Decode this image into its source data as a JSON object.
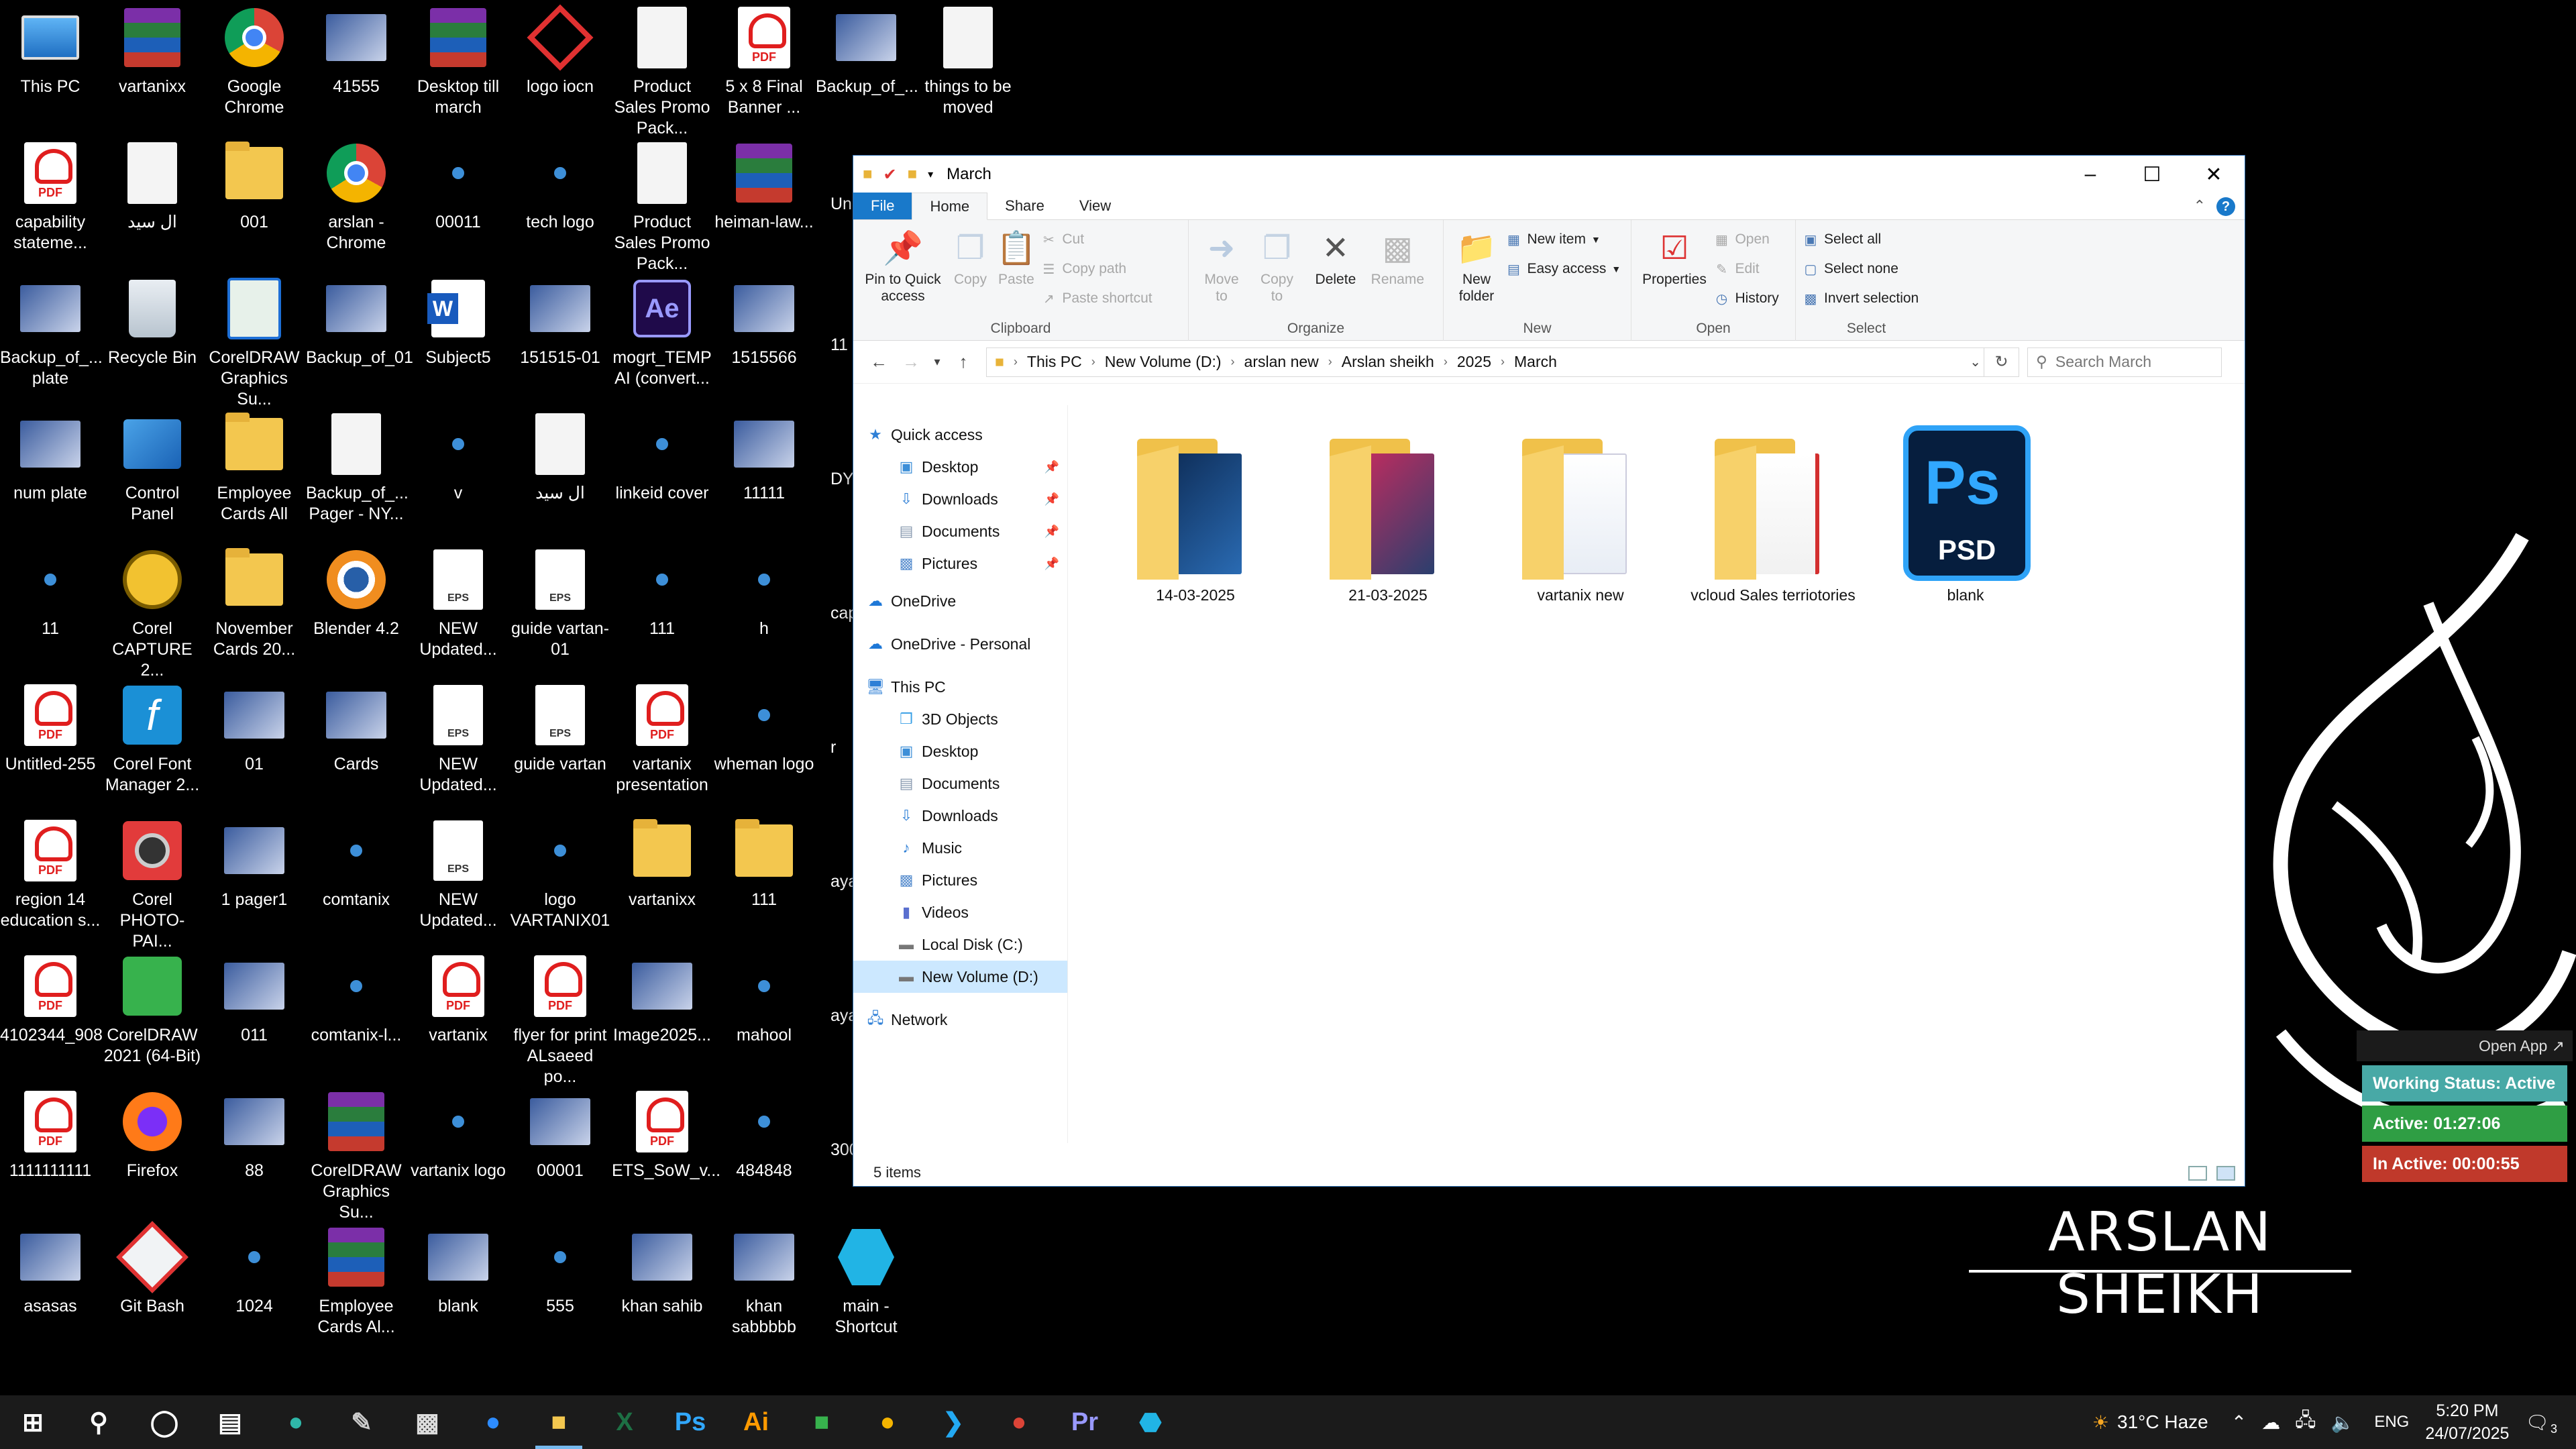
{
  "desktop": {
    "icons": [
      {
        "label": "This PC",
        "type": "pc"
      },
      {
        "label": "vartanixx",
        "type": "rar"
      },
      {
        "label": "Google Chrome",
        "type": "chrome"
      },
      {
        "label": "41555",
        "type": "img"
      },
      {
        "label": "Desktop till march",
        "type": "rar"
      },
      {
        "label": "logo iocn",
        "type": "logo"
      },
      {
        "label": "Product Sales Promo Pack...",
        "type": "doc"
      },
      {
        "label": "5 x 8 Final Banner ...",
        "type": "pdf"
      },
      {
        "label": "Backup_of_...",
        "type": "img"
      },
      {
        "label": "things to be moved",
        "type": "doc"
      },
      {
        "label": "capability stateme...",
        "type": "pdf"
      },
      {
        "label": "ال سید",
        "type": "doc"
      },
      {
        "label": "001",
        "type": "folder"
      },
      {
        "label": "arslan - Chrome",
        "type": "chrome"
      },
      {
        "label": "00011",
        "type": "small"
      },
      {
        "label": "tech logo",
        "type": "small"
      },
      {
        "label": "Product Sales Promo Pack...",
        "type": "doc"
      },
      {
        "label": "heiman-law...",
        "type": "rar"
      },
      {
        "label": "Backup_of_... plate",
        "type": "img"
      },
      {
        "label": "Recycle Bin",
        "type": "bin"
      },
      {
        "label": "CorelDRAW Graphics Su...",
        "type": "corel"
      },
      {
        "label": "Backup_of_01",
        "type": "img"
      },
      {
        "label": "Subject5",
        "type": "word"
      },
      {
        "label": "151515-01",
        "type": "img"
      },
      {
        "label": "mogrt_TEMP AI (convert...",
        "type": "ae"
      },
      {
        "label": "1515566",
        "type": "img"
      },
      {
        "label": "num plate",
        "type": "img"
      },
      {
        "label": "Control Panel",
        "type": "cp"
      },
      {
        "label": "Employee Cards All",
        "type": "folder"
      },
      {
        "label": "Backup_of_... Pager - NY...",
        "type": "doc"
      },
      {
        "label": "v",
        "type": "small"
      },
      {
        "label": "ال سید",
        "type": "doc"
      },
      {
        "label": "linkeid cover",
        "type": "small"
      },
      {
        "label": "11111",
        "type": "img"
      },
      {
        "label": "11",
        "type": "small"
      },
      {
        "label": "Corel CAPTURE 2...",
        "type": "corelcap"
      },
      {
        "label": "November Cards 20...",
        "type": "folder"
      },
      {
        "label": "Blender 4.2",
        "type": "blender"
      },
      {
        "label": "NEW Updated...",
        "type": "eps"
      },
      {
        "label": "guide vartan-01",
        "type": "eps"
      },
      {
        "label": "111",
        "type": "small"
      },
      {
        "label": "h",
        "type": "small"
      },
      {
        "label": "Untitled-255",
        "type": "pdf"
      },
      {
        "label": "Corel Font Manager 2...",
        "type": "corelfont"
      },
      {
        "label": "01",
        "type": "img"
      },
      {
        "label": "Cards",
        "type": "img"
      },
      {
        "label": "NEW Updated...",
        "type": "eps"
      },
      {
        "label": "guide vartan",
        "type": "eps"
      },
      {
        "label": "vartanix presentation",
        "type": "pdf"
      },
      {
        "label": "wheman logo",
        "type": "small"
      },
      {
        "label": "region 14 education s...",
        "type": "pdf"
      },
      {
        "label": "Corel PHOTO-PAI...",
        "type": "corelphoto"
      },
      {
        "label": "1 pager1",
        "type": "img"
      },
      {
        "label": "comtanix",
        "type": "small"
      },
      {
        "label": "NEW Updated...",
        "type": "eps"
      },
      {
        "label": "logo VARTANIX01",
        "type": "small"
      },
      {
        "label": "vartanixx",
        "type": "folder"
      },
      {
        "label": "111",
        "type": "folder"
      },
      {
        "label": "4102344_908",
        "type": "pdf"
      },
      {
        "label": "CorelDRAW 2021 (64-Bit)",
        "type": "coreldraw"
      },
      {
        "label": "011",
        "type": "img"
      },
      {
        "label": "comtanix-l...",
        "type": "small"
      },
      {
        "label": "vartanix",
        "type": "pdf"
      },
      {
        "label": "flyer for print ALsaeed po...",
        "type": "pdf"
      },
      {
        "label": "Image2025...",
        "type": "img"
      },
      {
        "label": "mahool",
        "type": "small"
      },
      {
        "label": "1111111111",
        "type": "pdf"
      },
      {
        "label": "Firefox",
        "type": "firefox"
      },
      {
        "label": "88",
        "type": "img"
      },
      {
        "label": "CorelDRAW Graphics Su...",
        "type": "rar"
      },
      {
        "label": "vartanix logo",
        "type": "small"
      },
      {
        "label": "00001",
        "type": "img"
      },
      {
        "label": "ETS_SoW_v...",
        "type": "pdf"
      },
      {
        "label": "484848",
        "type": "small"
      },
      {
        "label": "asasas",
        "type": "img"
      },
      {
        "label": "Git Bash",
        "type": "git"
      },
      {
        "label": "1024",
        "type": "small"
      },
      {
        "label": "Employee Cards Al...",
        "type": "rar"
      },
      {
        "label": "blank",
        "type": "img"
      },
      {
        "label": "555",
        "type": "small"
      },
      {
        "label": "khan sahib",
        "type": "img"
      },
      {
        "label": "khan sabbbbb",
        "type": "img"
      },
      {
        "label": "main - Shortcut",
        "type": "shortcut"
      }
    ],
    "partial_labels": [
      "Un",
      "11",
      "DY",
      "cap sta",
      "r",
      "aya",
      "aya",
      "300"
    ]
  },
  "explorer": {
    "title": "March",
    "window_controls": {
      "minimize": "–",
      "maximize": "☐",
      "close": "✕"
    },
    "tabs": [
      "File",
      "Home",
      "Share",
      "View"
    ],
    "active_tab": "Home",
    "ribbon": {
      "clipboard": {
        "name": "Clipboard",
        "pin": "Pin to Quick access",
        "copy": "Copy",
        "paste": "Paste",
        "cut": "Cut",
        "copy_path": "Copy path",
        "paste_shortcut": "Paste shortcut"
      },
      "organize": {
        "name": "Organize",
        "move_to": "Move to",
        "copy_to": "Copy to",
        "delete": "Delete",
        "rename": "Rename"
      },
      "new": {
        "name": "New",
        "new_folder": "New folder",
        "new_item": "New item",
        "easy_access": "Easy access"
      },
      "open": {
        "name": "Open",
        "properties": "Properties",
        "open": "Open",
        "edit": "Edit",
        "history": "History"
      },
      "select": {
        "name": "Select",
        "select_all": "Select all",
        "select_none": "Select none",
        "invert": "Invert selection"
      }
    },
    "address": {
      "crumbs": [
        "This PC",
        "New Volume (D:)",
        "arslan new",
        "Arslan sheikh",
        "2025",
        "March"
      ]
    },
    "search": {
      "placeholder": "Search March"
    },
    "nav": {
      "quick_access": "Quick access",
      "quick_items": [
        {
          "label": "Desktop",
          "pinned": true
        },
        {
          "label": "Downloads",
          "pinned": true
        },
        {
          "label": "Documents",
          "pinned": true
        },
        {
          "label": "Pictures",
          "pinned": true
        }
      ],
      "onedrive": "OneDrive",
      "onedrive_personal": "OneDrive - Personal",
      "this_pc": "This PC",
      "pc_items": [
        "3D Objects",
        "Desktop",
        "Documents",
        "Downloads",
        "Music",
        "Pictures",
        "Videos",
        "Local Disk (C:)",
        "New Volume (D:)"
      ],
      "selected": "New Volume (D:)",
      "network": "Network"
    },
    "items": [
      {
        "name": "14-03-2025",
        "kind": "folder"
      },
      {
        "name": "21-03-2025",
        "kind": "folder"
      },
      {
        "name": "vartanix new",
        "kind": "folder"
      },
      {
        "name": "vcloud Sales terriotories",
        "kind": "folder"
      },
      {
        "name": "blank",
        "kind": "psd"
      }
    ],
    "psd_icon": {
      "ps": "Ps",
      "ext": "PSD"
    },
    "status": "5 items"
  },
  "tracker": {
    "open_app": "Open App ↗",
    "working_status": "Working Status: Active",
    "active": "Active: 01:27:06",
    "inactive": "In Active: 00:00:55",
    "colors": {
      "status": "#48a9a6",
      "active": "#2f9e44",
      "inactive": "#c0392b"
    }
  },
  "brand": {
    "text": "ARSLAN SHEIKH"
  },
  "taskbar": {
    "apps": [
      "start-icon",
      "search-icon",
      "cortana-icon",
      "task-view-icon",
      "edge-icon",
      "pen-icon",
      "terminal-icon",
      "zoom-icon",
      "file-explorer-icon",
      "excel-icon",
      "photoshop-icon",
      "illustrator-icon",
      "coreldraw-icon",
      "chrome-icon",
      "vscode-icon",
      "chrome-profile-icon",
      "premiere-icon",
      "app-icon"
    ],
    "active": "file-explorer-icon",
    "weather": "31°C  Haze",
    "lang": "ENG",
    "time": "5:20 PM",
    "date": "24/07/2025",
    "notifications": "3"
  }
}
